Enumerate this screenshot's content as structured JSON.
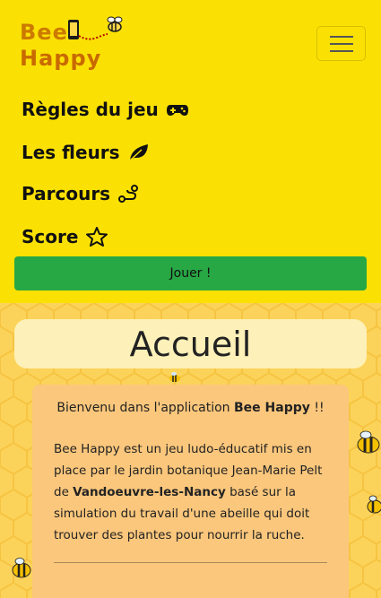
{
  "brand": {
    "line1": "Bee",
    "line2": "Happy"
  },
  "navbar": {
    "links": [
      {
        "label": "Règles du jeu",
        "icon": "gamepad-icon"
      },
      {
        "label": "Les fleurs",
        "icon": "leaf-icon"
      },
      {
        "label": "Parcours",
        "icon": "route-icon"
      },
      {
        "label": "Score",
        "icon": "star-icon"
      }
    ],
    "play_label": "Jouer !"
  },
  "page": {
    "title": "Accueil",
    "welcome_prefix": "Bienvenu dans l'application ",
    "welcome_app": "Bee Happy",
    "welcome_suffix": " !!",
    "desc_part1": "Bee Happy est un jeu ludo-éducatif mis en place par le jardin botanique Jean-Marie Pelt de ",
    "desc_place": "Vandoeuvre-les-Nancy",
    "desc_part2": " basé sur la simulation du travail d'une abeille qui doit trouver des plantes pour nourrir la ruche."
  },
  "colors": {
    "navbar_bg": "#fbe103",
    "play_button": "#28a745",
    "honeycomb_bg": "#fcd35a",
    "card_bg": "#fbc77c",
    "title_bg": "#fdf0b8"
  }
}
